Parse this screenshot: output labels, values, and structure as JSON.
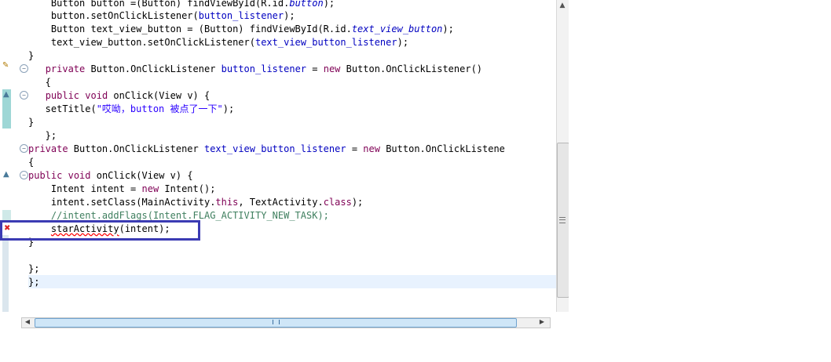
{
  "editor": {
    "lines": [
      {
        "id": "l1",
        "text": "    Button button =(Button) findViewById(R.id.button);"
      },
      {
        "id": "l2",
        "text": "    button.setOnClickListener(button_listener);"
      },
      {
        "id": "l3",
        "text": "    Button text_view_button = (Button) findViewById(R.id.text_view_button);"
      },
      {
        "id": "l4",
        "text": "    text_view_button.setOnClickListener(text_view_button_listener);"
      },
      {
        "id": "l5",
        "text": "}"
      },
      {
        "id": "l6",
        "text": "   private Button.OnClickListener button_listener = new Button.OnClickListener()"
      },
      {
        "id": "l7",
        "text": "   {"
      },
      {
        "id": "l8",
        "text": "   public void onClick(View v) {"
      },
      {
        "id": "l9",
        "text": "   setTitle(\"哎呦，button 被点了一下\");"
      },
      {
        "id": "l10",
        "text": "}"
      },
      {
        "id": "l11",
        "text": "   };"
      },
      {
        "id": "l12",
        "text": "private Button.OnClickListener text_view_button_listener = new Button.OnClickListene"
      },
      {
        "id": "l13",
        "text": "{"
      },
      {
        "id": "l14",
        "text": "public void onClick(View v) {"
      },
      {
        "id": "l15",
        "text": "    Intent intent = new Intent();"
      },
      {
        "id": "l16",
        "text": "    intent.setClass(MainActivity.this, TextActivity.class);"
      },
      {
        "id": "l17",
        "text": "    //intent.addFlags(Intent.FLAG_ACTIVITY_NEW_TASK);"
      },
      {
        "id": "l18",
        "text": "    starActivity(intent);"
      },
      {
        "id": "l19",
        "text": "}"
      },
      {
        "id": "l20",
        "text": ""
      },
      {
        "id": "l21",
        "text": "};"
      },
      {
        "id": "l22",
        "text": "};"
      }
    ],
    "error_method": "starActivity"
  },
  "colors": {
    "keyword": "#7f0055",
    "field": "#0000c0",
    "string": "#2a00ff",
    "comment": "#3f7f5f",
    "callout": "#3b3bb3",
    "current_line": "#e8f2fe"
  },
  "icons": [
    "fold-collapse-icon",
    "error-marker-icon",
    "override-marker-icon",
    "scroll-up-arrow-icon",
    "scroll-left-arrow-icon",
    "scroll-right-arrow-icon"
  ]
}
